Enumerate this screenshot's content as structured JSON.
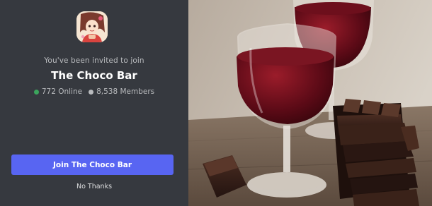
{
  "invite": {
    "subtitle": "You've been invited to join",
    "server_name": "The Choco Bar",
    "online_count": "772 Online",
    "member_count": "8,538 Members",
    "join_label": "Join The Choco Bar",
    "decline_label": "No Thanks"
  },
  "colors": {
    "background": "#36393f",
    "accent": "#5865f2",
    "online": "#3ba55c",
    "muted_text": "#b9bbbe"
  },
  "icons": {
    "server_icon": "anime-character-server-avatar",
    "online_dot": "green-status-dot",
    "members_dot": "grey-status-dot"
  }
}
